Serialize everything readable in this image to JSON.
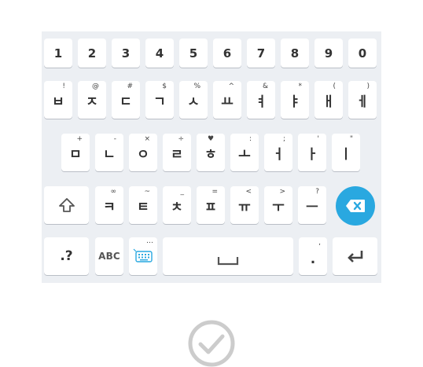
{
  "keyboard": {
    "number_row": [
      "1",
      "2",
      "3",
      "4",
      "5",
      "6",
      "7",
      "8",
      "9",
      "0"
    ],
    "row1": [
      {
        "main": "ㅂ",
        "hint": "!"
      },
      {
        "main": "ㅈ",
        "hint": "@"
      },
      {
        "main": "ㄷ",
        "hint": "#"
      },
      {
        "main": "ㄱ",
        "hint": "$"
      },
      {
        "main": "ㅅ",
        "hint": "%"
      },
      {
        "main": "ㅛ",
        "hint": "^"
      },
      {
        "main": "ㅕ",
        "hint": "&"
      },
      {
        "main": "ㅑ",
        "hint": "*"
      },
      {
        "main": "ㅐ",
        "hint": "("
      },
      {
        "main": "ㅔ",
        "hint": ")"
      }
    ],
    "row2": [
      {
        "main": "ㅁ",
        "hint": "+"
      },
      {
        "main": "ㄴ",
        "hint": "-"
      },
      {
        "main": "ㅇ",
        "hint": "×"
      },
      {
        "main": "ㄹ",
        "hint": "÷"
      },
      {
        "main": "ㅎ",
        "hint": "♥"
      },
      {
        "main": "ㅗ",
        "hint": ":"
      },
      {
        "main": "ㅓ",
        "hint": ";"
      },
      {
        "main": "ㅏ",
        "hint": "'"
      },
      {
        "main": "ㅣ",
        "hint": "\""
      }
    ],
    "row3": [
      {
        "main": "ㅋ",
        "hint": "∞"
      },
      {
        "main": "ㅌ",
        "hint": "~"
      },
      {
        "main": "ㅊ",
        "hint": "_"
      },
      {
        "main": "ㅍ",
        "hint": "="
      },
      {
        "main": "ㅠ",
        "hint": "<"
      },
      {
        "main": "ㅜ",
        "hint": ">"
      },
      {
        "main": "ㅡ",
        "hint": "?"
      }
    ],
    "bottom": {
      "symbols_label": ".?",
      "abc_label": "ABC",
      "emoji_hint": "…",
      "period_label": ".",
      "period_hint": ","
    },
    "icons": {
      "shift": "shift-arrow-icon",
      "delete": "backspace-icon",
      "keyboard": "keyboard-settings-icon",
      "space": "space-bar-icon",
      "enter": "enter-return-icon",
      "confirm": "check-circle-icon"
    },
    "colors": {
      "background": "#eceff3",
      "key": "#ffffff",
      "accent": "#29a8e0",
      "check": "#cccccc"
    }
  }
}
